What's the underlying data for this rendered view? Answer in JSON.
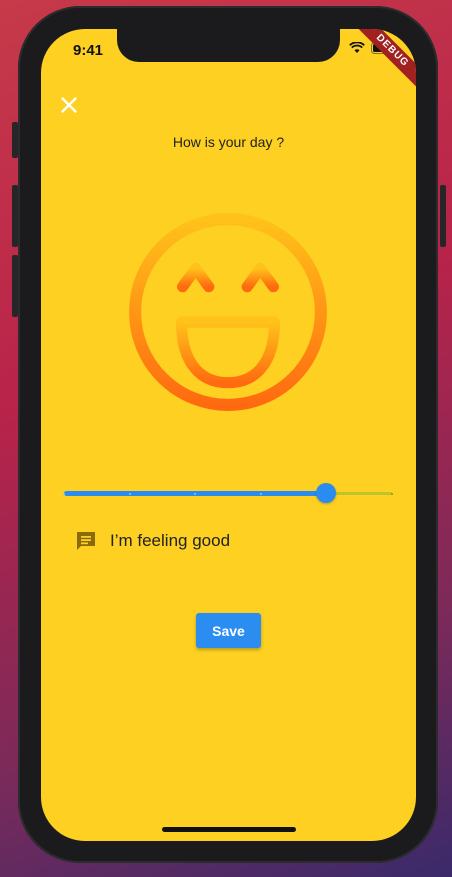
{
  "status_bar": {
    "time": "9:41"
  },
  "debug_banner": {
    "label": "DEBUG"
  },
  "question": "How is your day ?",
  "mood": {
    "emoji_icon": "laughing-face-icon",
    "slider_value": 0.8,
    "slider_divisions": 5
  },
  "feeling": {
    "icon": "message-icon",
    "text": "I’m feeling good"
  },
  "save_button": {
    "label": "Save"
  },
  "colors": {
    "background": "#fdd022",
    "accent": "#2a8cf0",
    "emoji_top": "#ffc21a",
    "emoji_bottom": "#ff6a10"
  }
}
